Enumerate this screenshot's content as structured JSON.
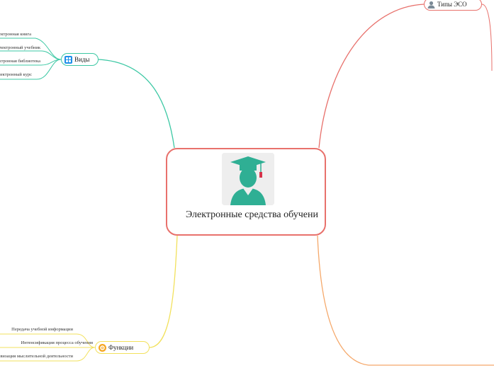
{
  "central": {
    "title": "Электронные средства обучени"
  },
  "branches": {
    "vidy": {
      "label": "Виды",
      "color": "#3cc8a4",
      "icon": "grid-icon",
      "items": [
        "Электронная книга",
        "Электронный учебник",
        "Электронная библиотека",
        "Электронный курс"
      ]
    },
    "funkcii": {
      "label": "Функции",
      "color": "#f2e15c",
      "icon": "gear-icon",
      "items": [
        "Передача учебной информации",
        "Интенсификация процесса обучения",
        "Активизация мыслительной деятельности"
      ]
    },
    "tipy": {
      "label": "Типы ЭСО",
      "color": "#e8716c",
      "icon": "user-icon"
    },
    "bottom_right": {
      "color": "#f5a86a"
    }
  }
}
